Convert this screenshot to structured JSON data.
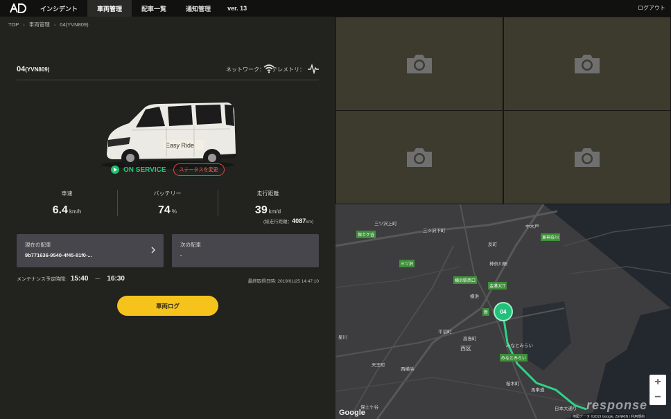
{
  "nav": {
    "items": [
      "インシデント",
      "車両管理",
      "配車一覧",
      "通知管理"
    ],
    "active_index": 1,
    "version": "ver. 13",
    "logout": "ログアウト"
  },
  "breadcrumb": [
    "TOP",
    "車両管理",
    "04(YVN809)"
  ],
  "vehicle": {
    "id": "04",
    "plate": "(YVN809)",
    "network_label": "ネットワーク：",
    "telemetry_label": "テレメトリ：",
    "livery_text": "Easy Ride",
    "status": "ON SERVICE",
    "status_color": "#25c877",
    "status_change_label": "ステータスを変更"
  },
  "stats": {
    "speed": {
      "label": "車速",
      "value": "6.4",
      "unit": "km/h"
    },
    "battery": {
      "label": "バッテリー",
      "value": "74",
      "unit": "%"
    },
    "distance": {
      "label": "走行距離",
      "value": "39",
      "unit": "km/d"
    },
    "total_label": "(総走行距離：",
    "total_value": "4087",
    "total_unit": "km)"
  },
  "dispatch": {
    "current_label": "現在の配車",
    "current_value": "9b771636-9540-4f45-81f0-...",
    "next_label": "次の配車",
    "next_value": "-"
  },
  "maintenance": {
    "label": "メンテナンス予定時間:",
    "start": "15:40",
    "dash": "—",
    "end": "16:30",
    "last_fetched": "最終取得日時: 2019/01/25 14:47:10"
  },
  "log_button": "車両ログ",
  "accent_color": "#f6c31d",
  "map": {
    "marker_label": "04",
    "google": "Google",
    "credit": "地図データ ©2019 Google, ZENRIN  |  利用規約",
    "watermark": "response",
    "labels": {
      "mitsuzawa_kami": "三ツ沢上町",
      "mitsuzawa_shimo": "三ツ沢下町",
      "nakakido": "中木戸",
      "higashi_kanagawa": "東神奈川",
      "tanmachi": "反町",
      "kanagawa_eki": "神奈川駅",
      "yokohama": "横浜",
      "takashimacho": "高島町",
      "nishiku": "西区",
      "minatomirai": "みなとみらい",
      "sakuragicho": "桜木町",
      "bashamichi": "馬車道",
      "nihon_odori": "日本大通り",
      "hiranuma": "平沼町",
      "hoshikawa": "星川",
      "tennocho": "天王町",
      "nishiyokohama": "西横浜",
      "hodogaya": "保土ケ谷",
      "tag_hodogaya": "保土ケ谷",
      "tag_mitsuzawa": "三ツ沢",
      "tag_yokohamaekinishi": "横浜駅西口",
      "tag_kinkojct": "金港JCT",
      "tag_minatomirai": "みなとみらい",
      "tag_higashikanagawa": "東神奈川",
      "tag_shin": "新"
    }
  }
}
